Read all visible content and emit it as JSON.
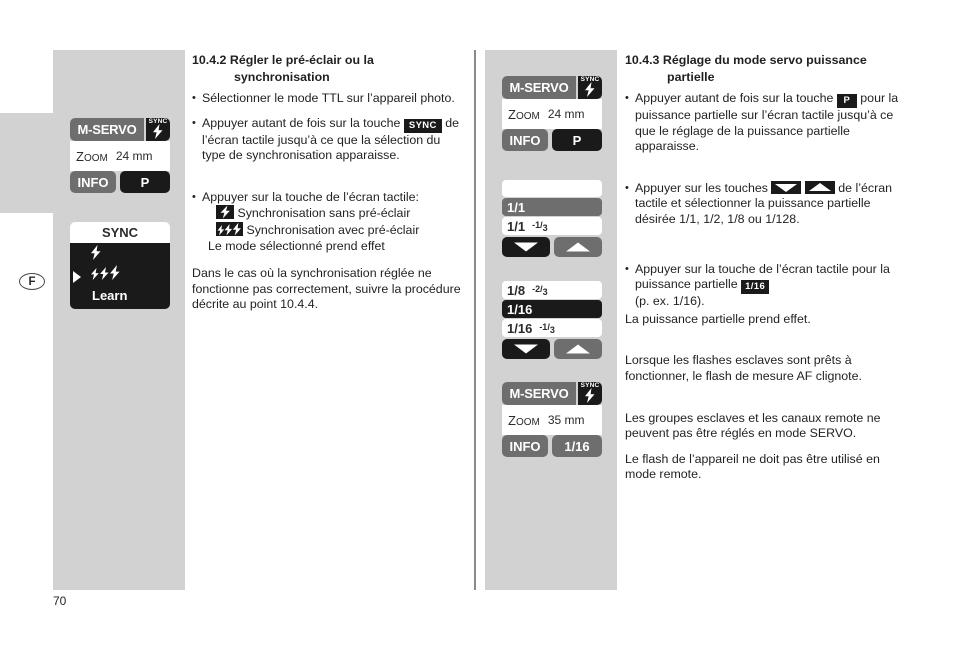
{
  "page": {
    "number": "70",
    "language_badge": "F"
  },
  "left_panel": {
    "display1": {
      "mode": "M-SERVO",
      "sync_tag": "SYNC",
      "sync_icon": "flash-bolt-icon",
      "zoom_label_cap": "Z",
      "zoom_label_rest": "OOM",
      "zoom_value": "24 mm",
      "buttons": [
        {
          "label": "INFO",
          "style": "gray"
        },
        {
          "label": "P",
          "style": "dark"
        }
      ]
    },
    "menu": {
      "title": "SYNC",
      "items": [
        {
          "icon": "single-bolt-icon",
          "label": "",
          "selected": false
        },
        {
          "icon": "triple-bolt-icon",
          "label": "",
          "selected": true
        },
        {
          "icon": "",
          "label": "Learn",
          "selected": false
        }
      ]
    }
  },
  "left_text": {
    "heading_number": "10.4.2",
    "heading_line1": "Régler le pré-éclair ou la",
    "heading_line2": "synchronisation",
    "bullets": [
      "Sélectionner le mode TTL sur l’appareil photo.",
      "Appuyer autant de fois sur la touche ",
      "Appuyer sur la touche de l’écran tactile:"
    ],
    "bullet2_key": "SYNC",
    "bullet2_rest": "de l’écran tactile jusqu’à ce que la sélection du type de synchronisation apparaisse.",
    "bullet3_sub1": "Synchronisation sans pré-éclair",
    "bullet3_sub2": "Synchronisation avec pré-éclair",
    "bullet3_sub3": "Le mode sélectionné prend effet",
    "closing": "Dans le cas où la synchronisation réglée ne fonctionne pas correctement, suivre la procédure décrite au point 10.4.4."
  },
  "mid_panel": {
    "display1": {
      "mode": "M-SERVO",
      "sync_tag": "SYNC",
      "zoom_label_cap": "Z",
      "zoom_label_rest": "OOM",
      "zoom_value": "24 mm",
      "buttons": [
        {
          "label": "INFO",
          "style": "gray"
        },
        {
          "label": "P",
          "style": "dark"
        }
      ]
    },
    "stack1": {
      "rows": [
        {
          "text": "",
          "frac_num": "",
          "frac_den": "",
          "style": "blank"
        },
        {
          "text": "1/1",
          "frac_num": "",
          "frac_den": "",
          "style": "hl-gray"
        },
        {
          "text": "1/1",
          "frac_num": "-1",
          "frac_den": "3",
          "style": "plain"
        }
      ],
      "arrow_down": "arrow-down-icon",
      "arrow_up": "arrow-up-icon"
    },
    "stack2": {
      "rows": [
        {
          "text": "1/8",
          "frac_num": "-2",
          "frac_den": "3",
          "style": "plain"
        },
        {
          "text": "1/16",
          "frac_num": "",
          "frac_den": "",
          "style": "hl-dark"
        },
        {
          "text": "1/16",
          "frac_num": "-1",
          "frac_den": "3",
          "style": "plain"
        }
      ],
      "arrow_down": "arrow-down-icon",
      "arrow_up": "arrow-up-icon"
    },
    "display2": {
      "mode": "M-SERVO",
      "sync_tag": "SYNC",
      "zoom_label_cap": "Z",
      "zoom_label_rest": "OOM",
      "zoom_value": "35 mm",
      "buttons": [
        {
          "label": "INFO",
          "style": "gray"
        },
        {
          "label": "1/16",
          "style": "gray"
        }
      ]
    }
  },
  "right_text": {
    "heading_number": "10.4.3",
    "heading_line1": "Réglage du mode servo puissance",
    "heading_line2": "partielle",
    "bullet1_lead": "Appuyer autant de fois sur la touche ",
    "bullet1_key": "P",
    "bullet1_rest": "pour la puissance partielle sur l’écran tactile jusqu’à ce que le réglage de la puissance partielle apparaisse.",
    "bullet2_lead": "Appuyer sur les touches ",
    "bullet2_rest": "de l’écran tactile et sélectionner la puissance partielle désirée 1/1, 1/2, 1/8 ou 1/128.",
    "bullet3_lead": "Appuyer sur la touche de l’écran tactile pour la puissance partielle ",
    "bullet3_key": "1/16",
    "bullet3_rest": "(p. ex. 1/16).",
    "para1": "La puissance partielle prend effet.",
    "para2": "Lorsque les flashes esclaves sont prêts à fonctionner, le flash de mesure AF clignote.",
    "para3": "Les groupes esclaves et les canaux remote ne peuvent pas être réglés en mode SERVO.",
    "para4": "Le flash de l’appareil ne doit pas être utilisé en mode remote."
  },
  "colors": {
    "panel_gray": "#d2d2d2",
    "segment_gray": "#6e6e6e",
    "segment_dark": "#1a1a1a",
    "text": "#231f20",
    "rule": "#8a8a8a"
  }
}
